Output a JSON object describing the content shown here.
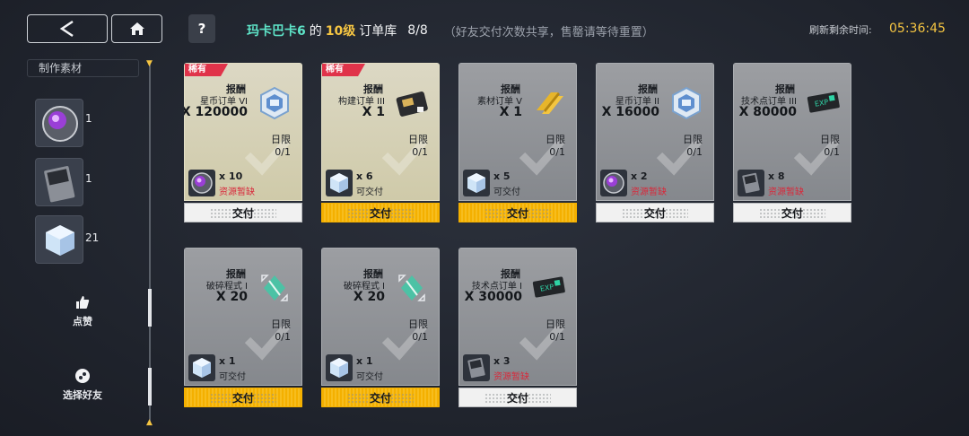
{
  "header": {
    "partner_name": "玛卡巴卡6",
    "of": "的",
    "level": "10级",
    "library": "订单库",
    "count": "8/8",
    "note": "（好友交付次数共享，售罄请等待重置）",
    "refresh_label": "刷新剩余时间:",
    "refresh_time": "05:36:45"
  },
  "sidebar": {
    "title": "制作素材",
    "materials": [
      {
        "name": "purple-orb-material",
        "count": "1"
      },
      {
        "name": "exp-card-material",
        "count": "1"
      },
      {
        "name": "crystal-cube-material",
        "count": "21"
      }
    ],
    "like_label": "点赞",
    "select_friend_label": "选择好友"
  },
  "cards": [
    {
      "rare": "稀有",
      "reward_label": "报酬",
      "reward_name": "星币订单 VI",
      "reward_qty": "X 120000",
      "reward_icon": "star-coin-order-icon",
      "limit_label": "日限",
      "limit_value": "0/1",
      "req_icon": "purple-orb-icon",
      "req_qty": "x 10",
      "req_status": "资源暂缺",
      "short": true,
      "deliver": "交付",
      "active": false,
      "style": "gold"
    },
    {
      "rare": "稀有",
      "reward_label": "报酬",
      "reward_name": "构建订单 III",
      "reward_qty": "X 1",
      "reward_icon": "build-order-icon",
      "limit_label": "日限",
      "limit_value": "0/1",
      "req_icon": "crystal-cube-icon",
      "req_qty": "x 6",
      "req_status": "可交付",
      "short": false,
      "deliver": "交付",
      "active": true,
      "style": "gold"
    },
    {
      "rare": "",
      "reward_label": "报酬",
      "reward_name": "素材订单 V",
      "reward_qty": "X 1",
      "reward_icon": "gold-bars-icon",
      "limit_label": "日限",
      "limit_value": "0/1",
      "req_icon": "crystal-cube-icon",
      "req_qty": "x 5",
      "req_status": "可交付",
      "short": false,
      "deliver": "交付",
      "active": true,
      "style": "grey"
    },
    {
      "rare": "",
      "reward_label": "报酬",
      "reward_name": "星币订单 II",
      "reward_qty": "X 16000",
      "reward_icon": "star-coin-order-icon",
      "limit_label": "日限",
      "limit_value": "0/1",
      "req_icon": "purple-orb-icon",
      "req_qty": "x 2",
      "req_status": "资源暂缺",
      "short": true,
      "deliver": "交付",
      "active": false,
      "style": "grey"
    },
    {
      "rare": "",
      "reward_label": "报酬",
      "reward_name": "技术点订单 III",
      "reward_qty": "X 80000",
      "reward_icon": "exp-ticket-icon",
      "limit_label": "日限",
      "limit_value": "0/1",
      "req_icon": "exp-card-icon",
      "req_qty": "x 8",
      "req_status": "资源暂缺",
      "short": true,
      "deliver": "交付",
      "active": false,
      "style": "grey"
    },
    {
      "rare": "",
      "reward_label": "报酬",
      "reward_name": "破碎程式 I",
      "reward_qty": "X 20",
      "reward_icon": "broken-program-icon",
      "limit_label": "日限",
      "limit_value": "0/1",
      "req_icon": "crystal-cube-icon",
      "req_qty": "x 1",
      "req_status": "可交付",
      "short": false,
      "deliver": "交付",
      "active": true,
      "style": "grey"
    },
    {
      "rare": "",
      "reward_label": "报酬",
      "reward_name": "破碎程式 I",
      "reward_qty": "X 20",
      "reward_icon": "broken-program-icon",
      "limit_label": "日限",
      "limit_value": "0/1",
      "req_icon": "crystal-cube-icon",
      "req_qty": "x 1",
      "req_status": "可交付",
      "short": false,
      "deliver": "交付",
      "active": true,
      "style": "grey"
    },
    {
      "rare": "",
      "reward_label": "报酬",
      "reward_name": "技术点订单 I",
      "reward_qty": "X 30000",
      "reward_icon": "exp-ticket-icon",
      "limit_label": "日限",
      "limit_value": "0/1",
      "req_icon": "exp-card-icon",
      "req_qty": "x 3",
      "req_status": "资源暂缺",
      "short": true,
      "deliver": "交付",
      "active": false,
      "style": "grey"
    }
  ]
}
